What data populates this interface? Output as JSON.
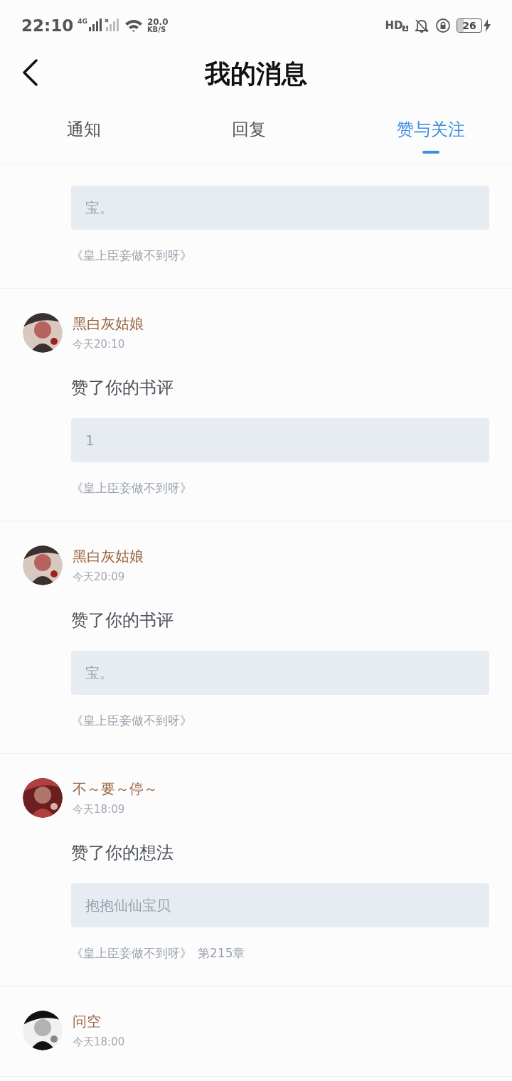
{
  "status_bar": {
    "time": "22:10",
    "network_type": "4G",
    "speed_value": "20.0",
    "speed_unit": "KB/S",
    "hd_label": "HD",
    "hd_sim": "1",
    "battery": "26",
    "charging": true
  },
  "header": {
    "title": "我的消息"
  },
  "tabs": [
    {
      "label": "通知",
      "selected": false
    },
    {
      "label": "回复",
      "selected": false
    },
    {
      "label": "赞与关注",
      "selected": true
    }
  ],
  "messages": [
    {
      "quote": "宝。",
      "book": "《皇上臣妾做不到呀》"
    },
    {
      "user": "黑白灰姑娘",
      "time": "今天20:10",
      "action": "赞了你的书评",
      "quote": "1",
      "book": "《皇上臣妾做不到呀》"
    },
    {
      "user": "黑白灰姑娘",
      "time": "今天20:09",
      "action": "赞了你的书评",
      "quote": "宝。",
      "book": "《皇上臣妾做不到呀》"
    },
    {
      "user": "不～要～停～",
      "time": "今天18:09",
      "action": "赞了你的想法",
      "quote": "抱抱仙仙宝贝",
      "book": "《皇上臣妾做不到呀》",
      "chapter": "第215章"
    },
    {
      "user": "问空",
      "time": "今天18:00"
    }
  ]
}
